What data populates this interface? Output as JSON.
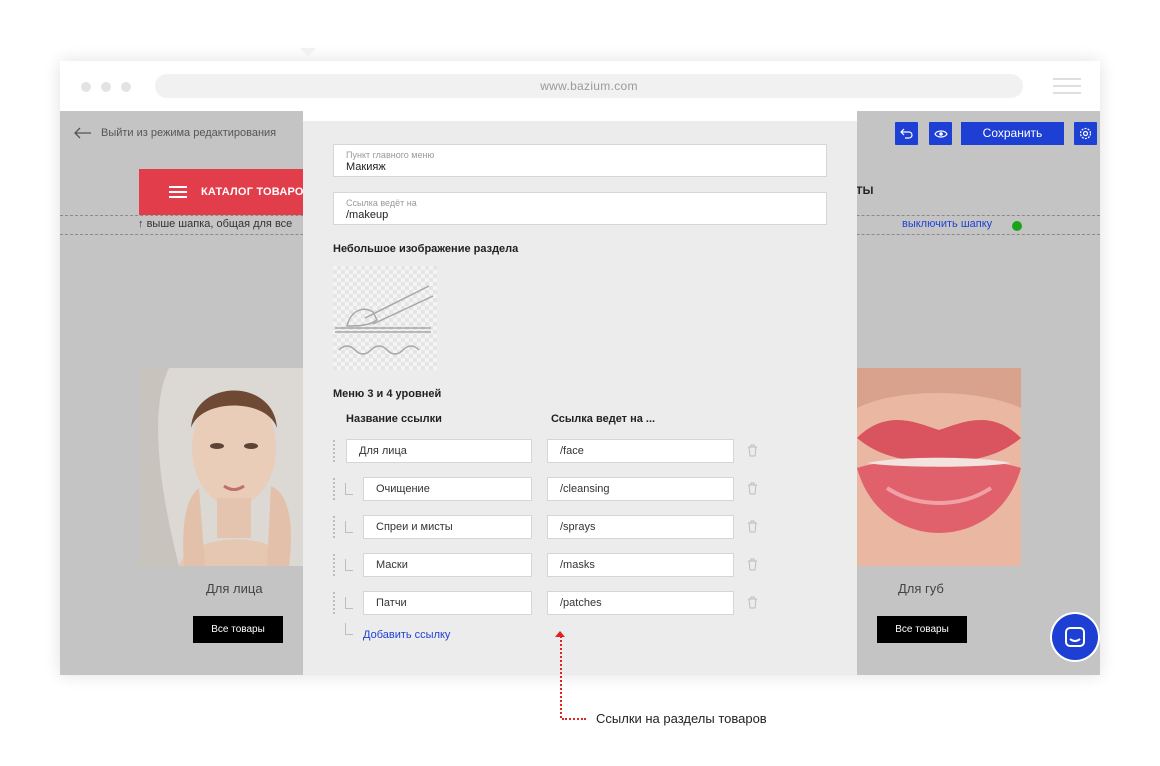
{
  "browser": {
    "url": "www.bazium.com"
  },
  "editbar": {
    "exit_label": "Выйти из режима редактирования",
    "save_label": "Сохранить"
  },
  "nav": {
    "catalog_label": "КАТАЛОГ ТОВАРО",
    "contacts_label": "АКТЫ"
  },
  "header_note": {
    "left": "выше шапка, общая для все",
    "right": "выключить шапку"
  },
  "cards": [
    {
      "title": "Для лица",
      "button": "Все товары"
    },
    {
      "title": "Для губ",
      "button": "Все товары"
    }
  ],
  "panel": {
    "menu_item": {
      "label": "Пункт главного меню",
      "value": "Макияж"
    },
    "link": {
      "label": "Ссылка ведёт на",
      "value": "/makeup"
    },
    "image_heading": "Небольшое изображение раздела",
    "submenu_heading": "Меню 3 и 4 уровней",
    "col_name": "Название ссылки",
    "col_link": "Ссылка ведет на ...",
    "rows": [
      {
        "name": "Для лица",
        "link": "/face",
        "level": 3
      },
      {
        "name": "Очищение",
        "link": "/cleansing",
        "level": 4
      },
      {
        "name": "Спреи и мисты",
        "link": "/sprays",
        "level": 4
      },
      {
        "name": "Маски",
        "link": "/masks",
        "level": 4
      },
      {
        "name": "Патчи",
        "link": "/patches",
        "level": 4
      }
    ],
    "add_link": "Добавить ссылку"
  },
  "annotation": "Ссылки на разделы товаров",
  "colors": {
    "accent": "#1e3fd4",
    "catalog": "#e13d4a",
    "annotation": "#dd2222",
    "status_on": "#1aa41a"
  }
}
